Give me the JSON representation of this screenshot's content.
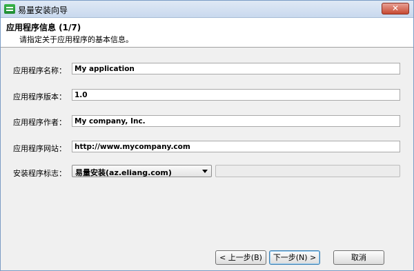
{
  "window": {
    "title": "易量安装向导",
    "close_label": "✕"
  },
  "header": {
    "title": "应用程序信息 (1/7)",
    "subtitle": "请指定关于应用程序的基本信息。"
  },
  "form": {
    "app_name": {
      "label": "应用程序名称：",
      "value": "My application"
    },
    "app_version": {
      "label": "应用程序版本：",
      "value": "1.0"
    },
    "app_author": {
      "label": "应用程序作者：",
      "value": "My company, Inc."
    },
    "app_website": {
      "label": "应用程序网站：",
      "value": "http://www.mycompany.com"
    },
    "installer_mark": {
      "label": "安装程序标志：",
      "selected": "易量安装(az.eliang.com)",
      "extra_value": ""
    }
  },
  "buttons": {
    "back": "< 上一步(B)",
    "next": "下一步(N) >",
    "cancel": "取消"
  },
  "icons": {
    "app_icon": "installer-app-icon",
    "close": "close-icon",
    "dropdown": "chevron-down-icon"
  },
  "colors": {
    "title_bar": "#c9d9ee",
    "close_button": "#c74a33",
    "header_bg": "#ffffff",
    "body_bg": "#f0f0f0"
  }
}
